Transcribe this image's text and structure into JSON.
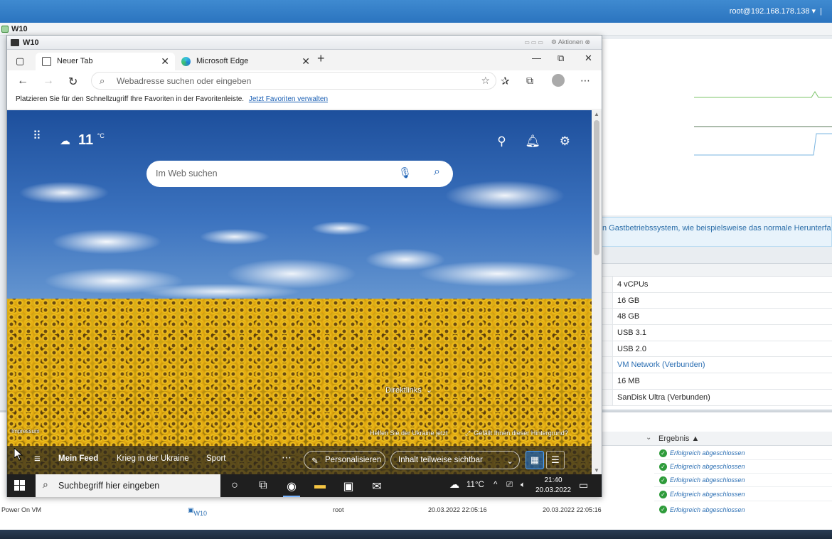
{
  "host": {
    "user": "root@192.168.178.138",
    "vm_name": "W10"
  },
  "info_banner": "n Gastbetriebssystem, wie beispielsweise das normale Herunterfahren",
  "hardware_rows": [
    {
      "value": "4 vCPUs",
      "link": false
    },
    {
      "value": "16 GB",
      "link": false
    },
    {
      "value": "48 GB",
      "link": false
    },
    {
      "value": "USB 3.1",
      "link": false
    },
    {
      "value": "USB 2.0",
      "link": false
    },
    {
      "value": "VM Network (Verbunden)",
      "link": true
    },
    {
      "value": "16 MB",
      "link": false
    },
    {
      "value": "SanDisk Ultra (Verbunden)",
      "link": false
    }
  ],
  "tasks": {
    "result_header": "Ergebnis ▲",
    "result_text": "Erfolgreich abgeschlossen",
    "last_row": {
      "task": "Power On VM",
      "target": "W10",
      "user": "root",
      "queued": "20.03.2022 22:05:16",
      "started": "20.03.2022 22:05:16"
    }
  },
  "console": {
    "title": "W10",
    "actions_label": "Aktionen"
  },
  "browser": {
    "tabs": [
      {
        "label": "Neuer Tab",
        "active": true
      },
      {
        "label": "Microsoft Edge",
        "active": false
      }
    ],
    "address_placeholder": "Webadresse suchen oder eingeben",
    "favorites_hint": "Platzieren Sie für den Schnellzugriff Ihre Favoriten in der Favoritenleiste.",
    "favorites_link": "Jetzt Favoriten verwalten"
  },
  "newtab": {
    "temperature": "11",
    "temp_unit": "°C",
    "search_placeholder": "Im Web suchen",
    "direktlinks": "Direktlinks",
    "impressum": "Impressum",
    "ukraine_help": "Helfen Sie der Ukraine jetzt",
    "bg_question": "Gefällt Ihnen dieser Hintergrund?",
    "feed": [
      "Mein Feed",
      "Krieg in der Ukraine",
      "Sport"
    ],
    "personalize": "Personalisieren",
    "content_visibility": "Inhalt teilweise sichtbar"
  },
  "taskbar": {
    "search_placeholder": "Suchbegriff hier eingeben",
    "weather": "11°C",
    "time": "21:40",
    "date": "20.03.2022"
  },
  "colors": {
    "esxi_blue": "#2b74bf",
    "link_blue": "#1a5fb4",
    "success_green": "#2e9b3a"
  }
}
